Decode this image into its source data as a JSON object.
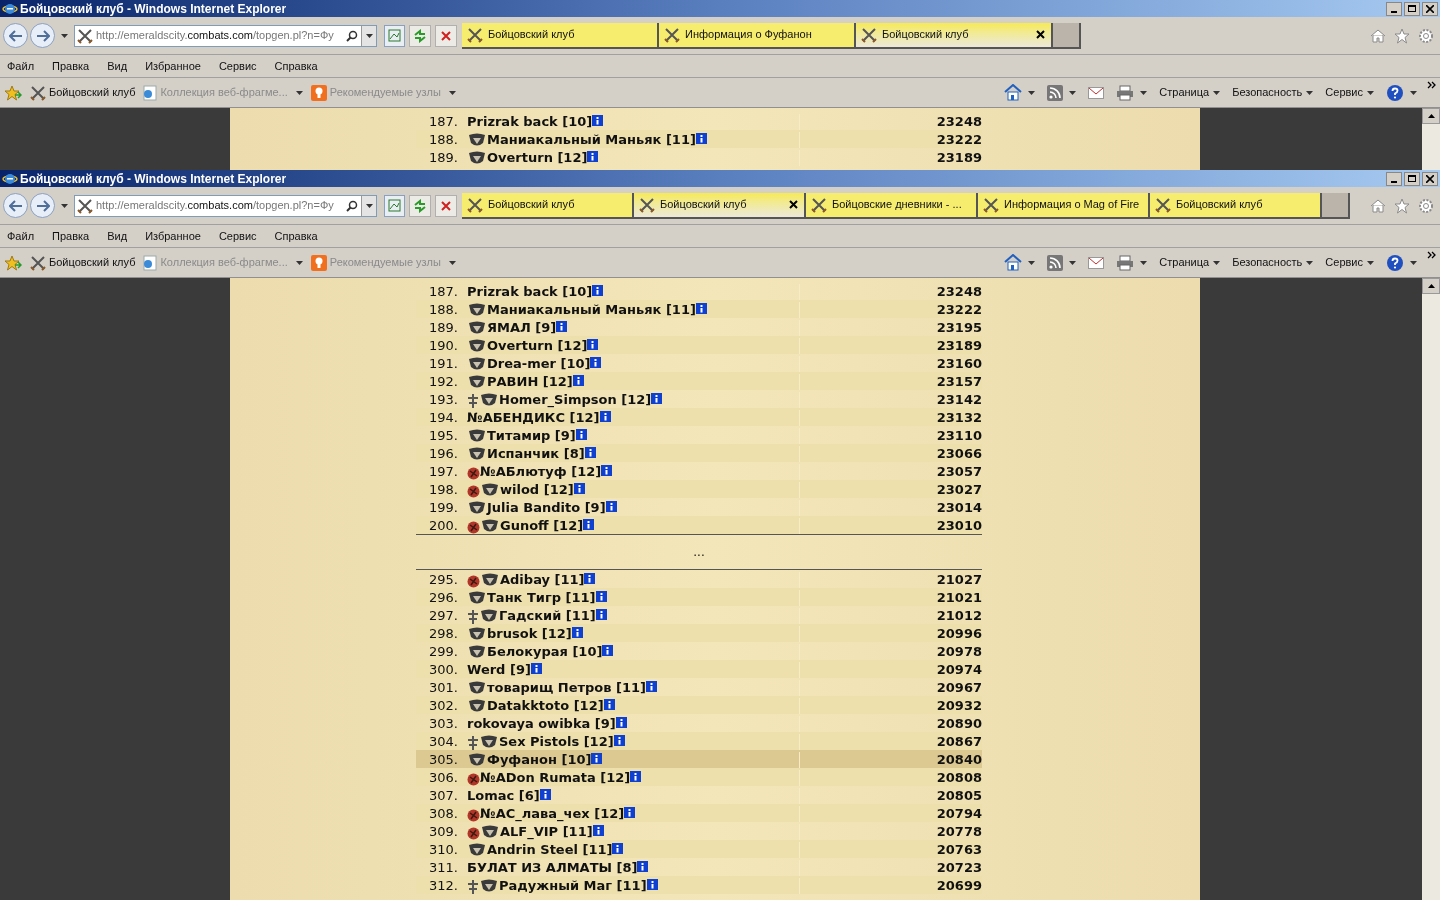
{
  "windows": [
    {
      "title": "Бойцовский клуб - Windows Internet Explorer",
      "address": {
        "prefix": "http://emeraldscity.",
        "domain": "combats.com",
        "rest": "/topgen.pl?n=Фу"
      },
      "tabs": [
        {
          "label": "Бойцовский клуб",
          "selected": false
        },
        {
          "label": "Информация о Фуфанон",
          "selected": false
        },
        {
          "label": "Бойцовский клуб",
          "selected": true
        }
      ],
      "menu": [
        "Файл",
        "Правка",
        "Вид",
        "Избранное",
        "Сервис",
        "Справка"
      ],
      "favorites": [
        {
          "label": "Бойцовский клуб",
          "disabled": false,
          "dropdown": false
        },
        {
          "label": "Коллекция веб-фрагме...",
          "disabled": true,
          "dropdown": true
        },
        {
          "label": "Рекомендуемые узлы",
          "disabled": true,
          "dropdown": true
        }
      ],
      "commands": [
        "Страница",
        "Безопасность",
        "Сервис"
      ],
      "sections": [
        [
          {
            "rank": "187.",
            "name": "Prizrak back [10]",
            "score": "23248",
            "selected": false
          },
          {
            "rank": "188.",
            "name": "Маниакальный Маньяк [11]",
            "score": "23222",
            "selected": false,
            "emblems": [
              {
                "kind": "clan"
              }
            ]
          },
          {
            "rank": "189.",
            "name": "Overturn [12]",
            "score": "23189",
            "selected": false,
            "emblems": [
              {
                "kind": "clan"
              }
            ]
          }
        ]
      ]
    },
    {
      "title": "Бойцовский клуб - Windows Internet Explorer",
      "address": {
        "prefix": "http://emeraldscity.",
        "domain": "combats.com",
        "rest": "/topgen.pl?n=Фу"
      },
      "tabs": [
        {
          "label": "Бойцовский клуб",
          "selected": false
        },
        {
          "label": "Бойцовский клуб",
          "selected": true
        },
        {
          "label": "Бойцовские дневники - ...",
          "selected": false
        },
        {
          "label": "Информация о Mag of Fire",
          "selected": false
        },
        {
          "label": "Бойцовский клуб",
          "selected": false
        }
      ],
      "menu": [
        "Файл",
        "Правка",
        "Вид",
        "Избранное",
        "Сервис",
        "Справка"
      ],
      "favorites": [
        {
          "label": "Бойцовский клуб",
          "disabled": false,
          "dropdown": false
        },
        {
          "label": "Коллекция веб-фрагме...",
          "disabled": true,
          "dropdown": true
        },
        {
          "label": "Рекомендуемые узлы",
          "disabled": true,
          "dropdown": true
        }
      ],
      "commands": [
        "Страница",
        "Безопасность",
        "Сервис"
      ],
      "gap": "...",
      "sections": [
        [
          {
            "rank": "187.",
            "name": "Prizrak back [10]",
            "score": "23248",
            "selected": false
          },
          {
            "rank": "188.",
            "name": "Маниакальный Маньяк [11]",
            "score": "23222",
            "selected": false,
            "emblems": [
              {
                "kind": "clan"
              }
            ]
          },
          {
            "rank": "189.",
            "name": "ЯМАЛ [9]",
            "score": "23195",
            "selected": false,
            "emblems": [
              {
                "kind": "clan"
              }
            ]
          },
          {
            "rank": "190.",
            "name": "Overturn [12]",
            "score": "23189",
            "selected": false,
            "emblems": [
              {
                "kind": "clan"
              }
            ]
          },
          {
            "rank": "191.",
            "name": "Drea-mer [10]",
            "score": "23160",
            "selected": false,
            "emblems": [
              {
                "kind": "clan"
              }
            ]
          },
          {
            "rank": "192.",
            "name": "РАВИН [12]",
            "score": "23157",
            "selected": false,
            "emblems": [
              {
                "kind": "clan"
              }
            ]
          },
          {
            "rank": "193.",
            "name": "Homer_Simpson [12]",
            "score": "23142",
            "selected": false,
            "emblems": [
              {
                "kind": "order"
              },
              {
                "kind": "clan"
              }
            ]
          },
          {
            "rank": "194.",
            "name": "№АБЕНДИКС [12]",
            "score": "23132",
            "selected": false
          },
          {
            "rank": "195.",
            "name": "Титамир [9]",
            "score": "23110",
            "selected": false,
            "emblems": [
              {
                "kind": "clan"
              }
            ]
          },
          {
            "rank": "196.",
            "name": "Испанчик [8]",
            "score": "23066",
            "selected": false,
            "emblems": [
              {
                "kind": "clan"
              }
            ]
          },
          {
            "rank": "197.",
            "name": "№АБлютуф [12]",
            "score": "23057",
            "selected": false,
            "emblems": [
              {
                "kind": "align"
              }
            ]
          },
          {
            "rank": "198.",
            "name": "wilod [12]",
            "score": "23027",
            "selected": false,
            "emblems": [
              {
                "kind": "align"
              },
              {
                "kind": "clan"
              }
            ]
          },
          {
            "rank": "199.",
            "name": "Julia Bandito [9]",
            "score": "23014",
            "selected": false,
            "emblems": [
              {
                "kind": "clan"
              }
            ]
          },
          {
            "rank": "200.",
            "name": "Gunoff [12]",
            "score": "23010",
            "selected": false,
            "emblems": [
              {
                "kind": "align"
              },
              {
                "kind": "clan"
              }
            ]
          }
        ],
        [
          {
            "rank": "295.",
            "name": "Adibay [11]",
            "score": "21027",
            "selected": false,
            "emblems": [
              {
                "kind": "align"
              },
              {
                "kind": "clan"
              }
            ]
          },
          {
            "rank": "296.",
            "name": "Танк Тигр [11]",
            "score": "21021",
            "selected": false,
            "emblems": [
              {
                "kind": "clan"
              }
            ]
          },
          {
            "rank": "297.",
            "name": "Гадский [11]",
            "score": "21012",
            "selected": false,
            "emblems": [
              {
                "kind": "order"
              },
              {
                "kind": "clan"
              }
            ]
          },
          {
            "rank": "298.",
            "name": "brusok [12]",
            "score": "20996",
            "selected": false,
            "emblems": [
              {
                "kind": "clan"
              }
            ]
          },
          {
            "rank": "299.",
            "name": "Белокурая [10]",
            "score": "20978",
            "selected": false,
            "emblems": [
              {
                "kind": "clan"
              }
            ]
          },
          {
            "rank": "300.",
            "name": "Werd [9]",
            "score": "20974",
            "selected": false
          },
          {
            "rank": "301.",
            "name": "товарищ Петров [11]",
            "score": "20967",
            "selected": false,
            "emblems": [
              {
                "kind": "clan"
              }
            ]
          },
          {
            "rank": "302.",
            "name": "Datakktoto [12]",
            "score": "20932",
            "selected": false,
            "emblems": [
              {
                "kind": "clan"
              }
            ]
          },
          {
            "rank": "303.",
            "name": "rokovaya owibka [9]",
            "score": "20890",
            "selected": false
          },
          {
            "rank": "304.",
            "name": "Sex Pistols [12]",
            "score": "20867",
            "selected": false,
            "emblems": [
              {
                "kind": "order"
              },
              {
                "kind": "clan"
              }
            ]
          },
          {
            "rank": "305.",
            "name": "Фуфанон [10]",
            "score": "20840",
            "selected": true,
            "emblems": [
              {
                "kind": "clan"
              }
            ]
          },
          {
            "rank": "306.",
            "name": "№ADon Rumata [12]",
            "score": "20808",
            "selected": false,
            "emblems": [
              {
                "kind": "align"
              }
            ]
          },
          {
            "rank": "307.",
            "name": "Lomac [6]",
            "score": "20805",
            "selected": false
          },
          {
            "rank": "308.",
            "name": "№AC_лава_чех [12]",
            "score": "20794",
            "selected": false,
            "emblems": [
              {
                "kind": "align"
              }
            ]
          },
          {
            "rank": "309.",
            "name": "ALF_VIP [11]",
            "score": "20778",
            "selected": false,
            "emblems": [
              {
                "kind": "align"
              },
              {
                "kind": "clan"
              }
            ]
          },
          {
            "rank": "310.",
            "name": "Andrin Steel [11]",
            "score": "20763",
            "selected": false,
            "emblems": [
              {
                "kind": "clan"
              }
            ]
          },
          {
            "rank": "311.",
            "name": "БУЛАТ ИЗ АЛМАТЫ [8]",
            "score": "20723",
            "selected": false
          },
          {
            "rank": "312.",
            "name": "Радужный Маг [11]",
            "score": "20699",
            "selected": false,
            "emblems": [
              {
                "kind": "order"
              },
              {
                "kind": "clan"
              }
            ]
          }
        ]
      ]
    }
  ]
}
